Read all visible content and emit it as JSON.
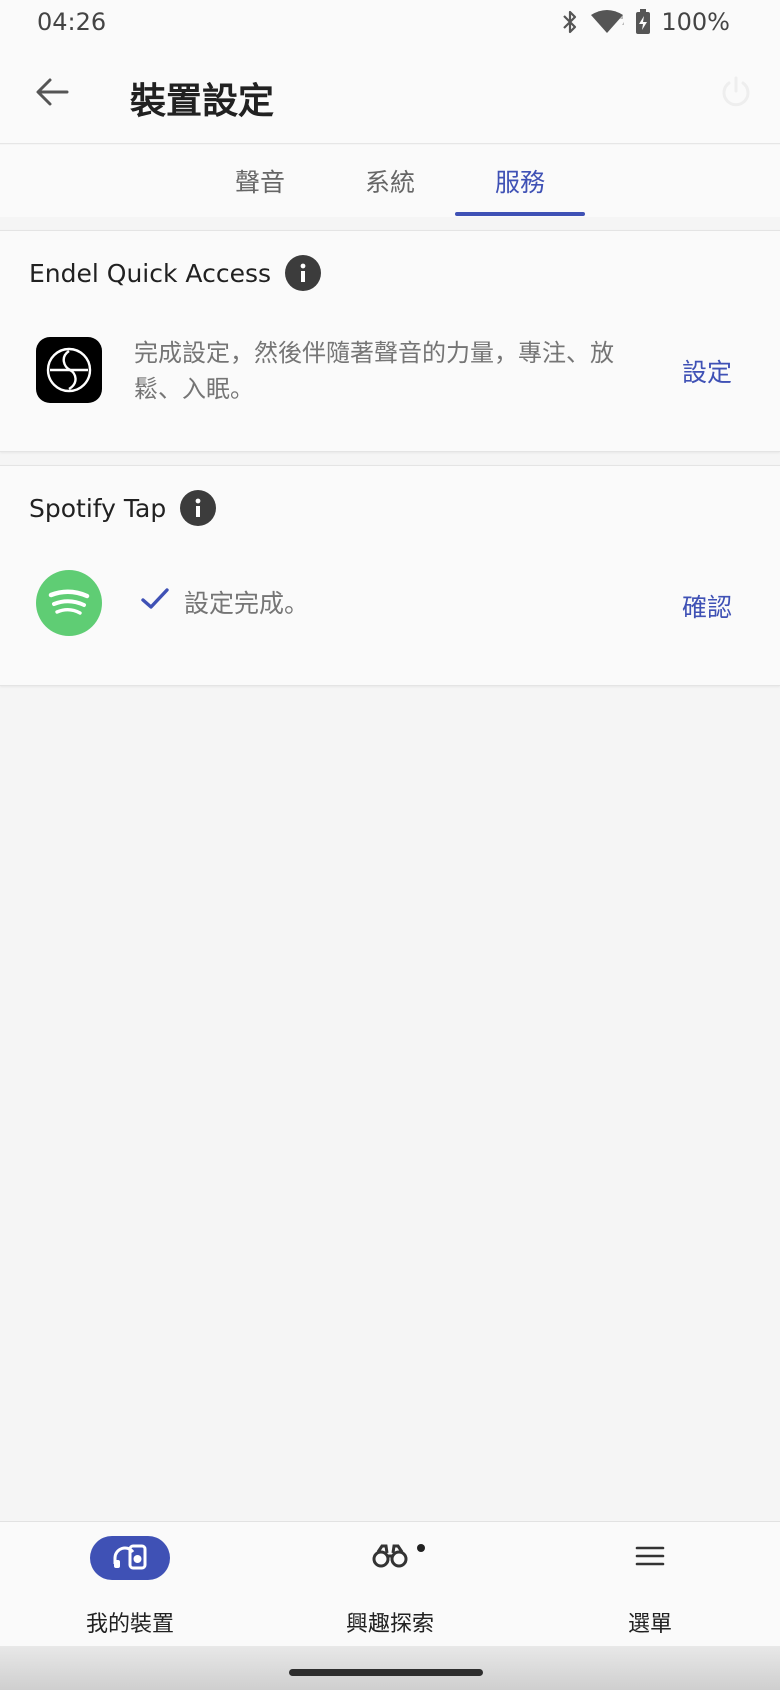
{
  "status_bar": {
    "time": "04:26",
    "battery": "100%",
    "icons": [
      "bluetooth-icon",
      "wifi-icon",
      "battery-charging-icon"
    ]
  },
  "app_bar": {
    "title": "裝置設定",
    "back_icon": "arrow-left-icon",
    "power_icon": "power-icon"
  },
  "tabs": [
    {
      "label": "聲音",
      "active": false
    },
    {
      "label": "系統",
      "active": false
    },
    {
      "label": "服務",
      "active": true
    }
  ],
  "services": {
    "endel": {
      "title": "Endel Quick Access",
      "description": "完成設定，然後伴隨著聲音的力量，專注、放鬆、入眠。",
      "action": "設定",
      "icon": "endel-logo-icon"
    },
    "spotify": {
      "title": "Spotify Tap",
      "status": "設定完成。",
      "action": "確認",
      "icon": "spotify-logo-icon"
    }
  },
  "bottom_nav": [
    {
      "label": "我的裝置",
      "icon": "headphones-device-icon",
      "active": true
    },
    {
      "label": "興趣探索",
      "icon": "binoculars-icon",
      "active": false,
      "badge": true
    },
    {
      "label": "選單",
      "icon": "menu-icon",
      "active": false
    }
  ],
  "colors": {
    "accent": "#3f51b5",
    "spotify_green": "#5fcd74",
    "background": "#f5f5f5",
    "surface": "#fafafa"
  }
}
